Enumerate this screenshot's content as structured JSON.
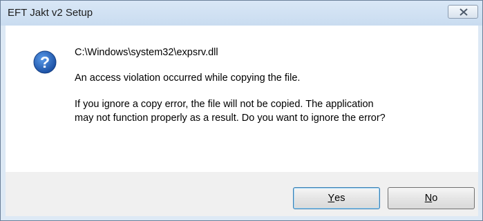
{
  "window": {
    "title": "EFT Jakt v2 Setup"
  },
  "message": {
    "path": "C:\\Windows\\system32\\expsrv.dll",
    "error": "An access violation occurred while copying the file.",
    "prompt_line1": "If you ignore a copy error, the file will not be copied.  The application",
    "prompt_line2": "may not function properly as a result.  Do you want to ignore the error?"
  },
  "buttons": {
    "yes": {
      "mnemonic": "Y",
      "rest": "es"
    },
    "no": {
      "mnemonic": "N",
      "rest": "o"
    }
  },
  "icons": {
    "dialog": "question-icon",
    "close": "close-icon"
  },
  "colors": {
    "title_bar": "#c9dcf0",
    "icon_blue": "#1f5db5"
  }
}
